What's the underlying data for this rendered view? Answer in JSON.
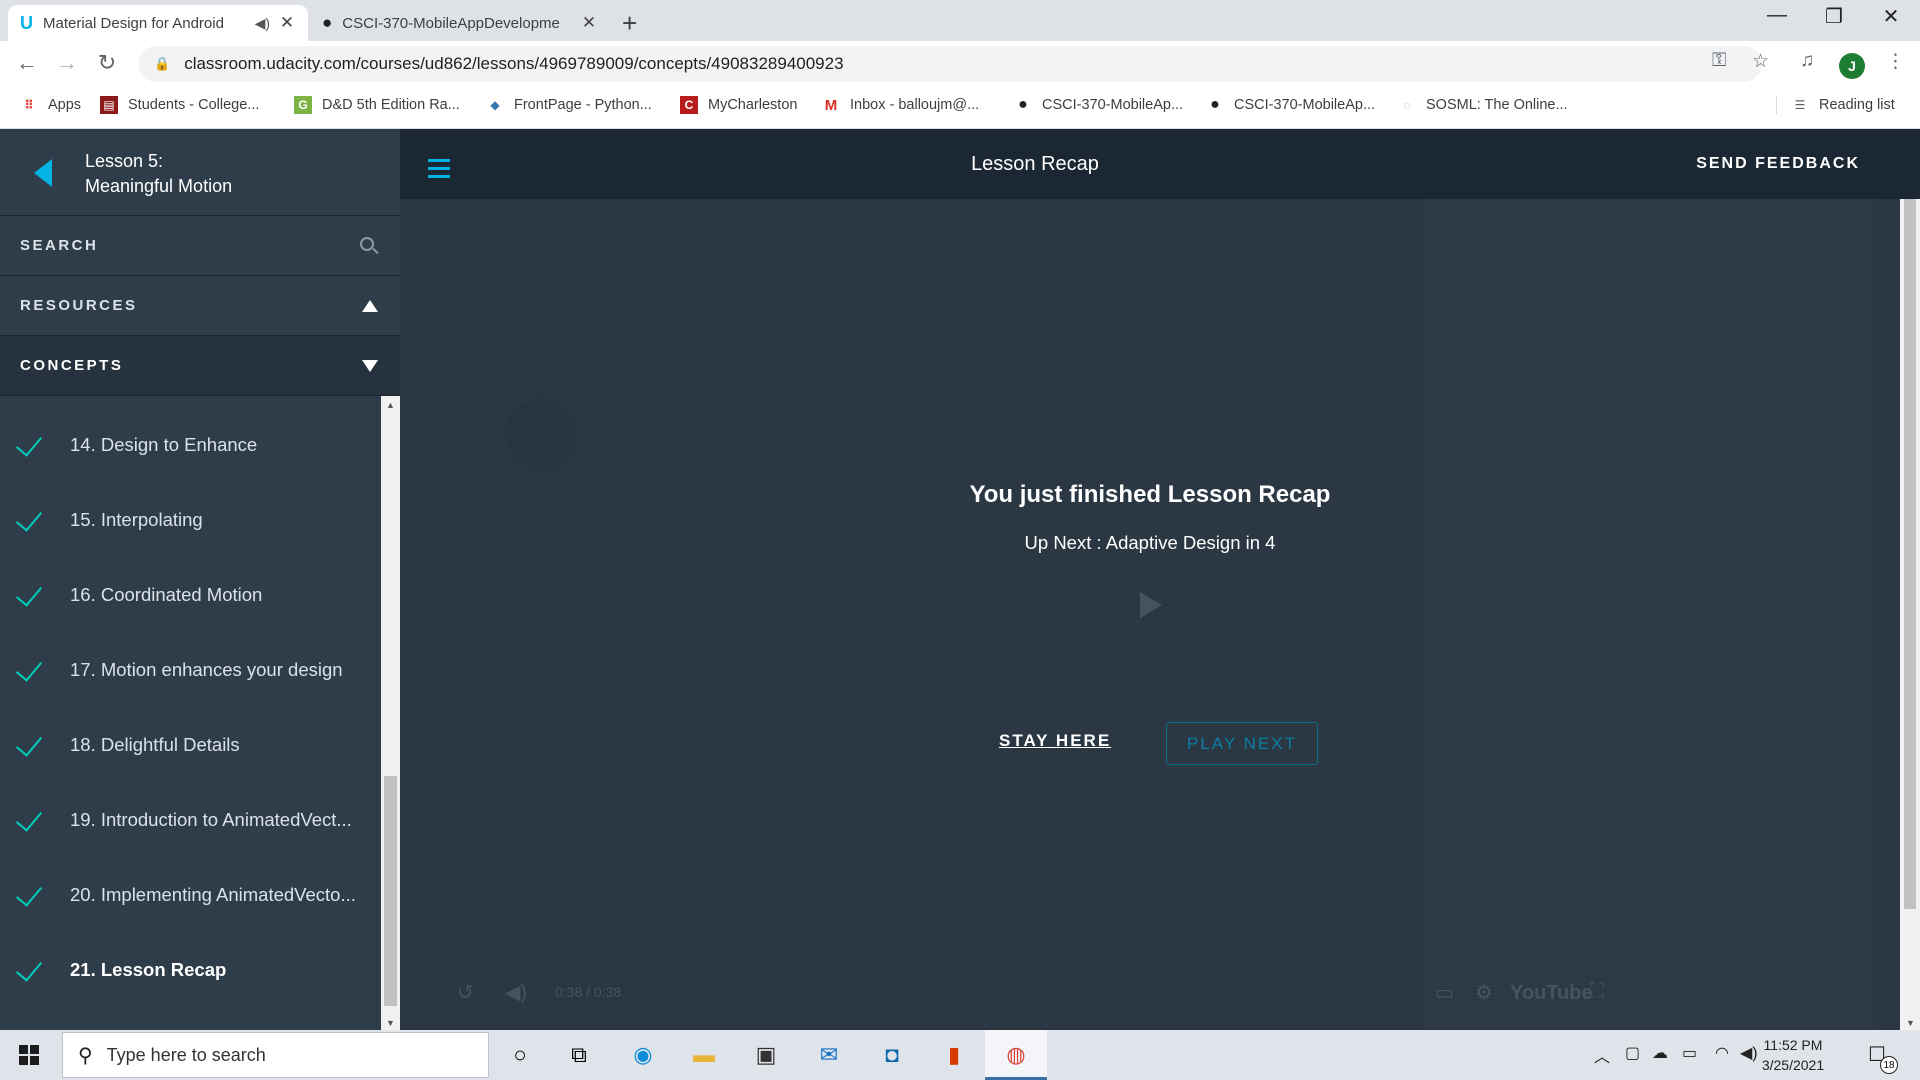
{
  "browser": {
    "tabs": [
      {
        "title": "Material Design for Android",
        "active": true,
        "icon": "udacity-icon"
      },
      {
        "title": "CSCI-370-MobileAppDevelopme",
        "active": false,
        "icon": "github-icon"
      }
    ],
    "url": "classroom.udacity.com/courses/ud862/lessons/4969789009/concepts/49083289400923",
    "avatar_letter": "J",
    "bookmarks": [
      {
        "label": "Apps",
        "icon": "apps-grid-icon"
      },
      {
        "label": "Students - College...",
        "icon": "college-icon"
      },
      {
        "label": "D&D 5th Edition Ra...",
        "icon": "dnd-icon"
      },
      {
        "label": "FrontPage - Python...",
        "icon": "python-icon"
      },
      {
        "label": "MyCharleston",
        "icon": "charleston-icon"
      },
      {
        "label": "Inbox - balloujm@...",
        "icon": "gmail-icon"
      },
      {
        "label": "CSCI-370-MobileAp...",
        "icon": "github-icon"
      },
      {
        "label": "CSCI-370-MobileAp...",
        "icon": "github-icon"
      },
      {
        "label": "SOSML: The Online...",
        "icon": "sosml-icon"
      }
    ],
    "reading_list": "Reading list"
  },
  "sidebar": {
    "lesson_number": "Lesson 5:",
    "lesson_title": "Meaningful Motion",
    "search_label": "SEARCH",
    "resources_label": "RESOURCES",
    "concepts_label": "CONCEPTS",
    "concepts": [
      {
        "label": "14. Design to Enhance",
        "done": true,
        "current": false
      },
      {
        "label": "15. Interpolating",
        "done": true,
        "current": false
      },
      {
        "label": "16. Coordinated Motion",
        "done": true,
        "current": false
      },
      {
        "label": "17. Motion enhances your design",
        "done": true,
        "current": false
      },
      {
        "label": "18. Delightful Details",
        "done": true,
        "current": false
      },
      {
        "label": "19. Introduction to AnimatedVect...",
        "done": true,
        "current": false
      },
      {
        "label": "20. Implementing AnimatedVecto...",
        "done": true,
        "current": false
      },
      {
        "label": "21. Lesson Recap",
        "done": true,
        "current": true
      }
    ]
  },
  "header": {
    "title": "Lesson Recap",
    "feedback_label": "SEND FEEDBACK"
  },
  "player": {
    "finished_text": "You just finished Lesson Recap",
    "up_next_text": "Up Next : Adaptive Design in 4",
    "stay_label": "STAY HERE",
    "play_next_label": "PLAY NEXT",
    "time": "0:38 / 0:38",
    "youtube_label": "YouTube"
  },
  "taskbar": {
    "search_placeholder": "Type here to search",
    "time": "11:52 PM",
    "date": "3/25/2021",
    "notification_count": "18"
  },
  "colors": {
    "accent": "#02b3e4",
    "check": "#02ccba",
    "sidebar_bg": "#2e3d49",
    "header_bg": "#1b2733"
  }
}
